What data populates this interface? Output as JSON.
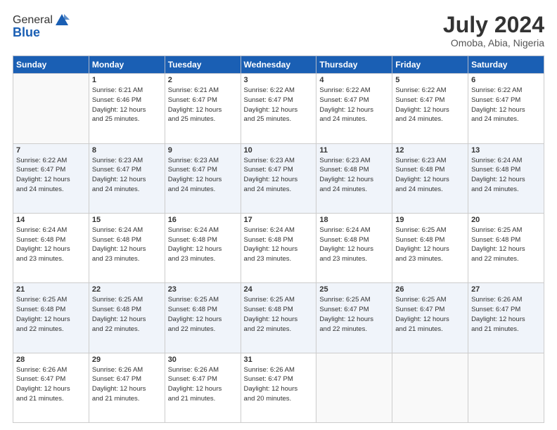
{
  "header": {
    "logo_general": "General",
    "logo_blue": "Blue",
    "month_year": "July 2024",
    "location": "Omoba, Abia, Nigeria"
  },
  "weekdays": [
    "Sunday",
    "Monday",
    "Tuesday",
    "Wednesday",
    "Thursday",
    "Friday",
    "Saturday"
  ],
  "weeks": [
    [
      {
        "day": "",
        "detail": ""
      },
      {
        "day": "1",
        "detail": "Sunrise: 6:21 AM\nSunset: 6:46 PM\nDaylight: 12 hours\nand 25 minutes."
      },
      {
        "day": "2",
        "detail": "Sunrise: 6:21 AM\nSunset: 6:47 PM\nDaylight: 12 hours\nand 25 minutes."
      },
      {
        "day": "3",
        "detail": "Sunrise: 6:22 AM\nSunset: 6:47 PM\nDaylight: 12 hours\nand 25 minutes."
      },
      {
        "day": "4",
        "detail": "Sunrise: 6:22 AM\nSunset: 6:47 PM\nDaylight: 12 hours\nand 24 minutes."
      },
      {
        "day": "5",
        "detail": "Sunrise: 6:22 AM\nSunset: 6:47 PM\nDaylight: 12 hours\nand 24 minutes."
      },
      {
        "day": "6",
        "detail": "Sunrise: 6:22 AM\nSunset: 6:47 PM\nDaylight: 12 hours\nand 24 minutes."
      }
    ],
    [
      {
        "day": "7",
        "detail": "Sunrise: 6:22 AM\nSunset: 6:47 PM\nDaylight: 12 hours\nand 24 minutes."
      },
      {
        "day": "8",
        "detail": "Sunrise: 6:23 AM\nSunset: 6:47 PM\nDaylight: 12 hours\nand 24 minutes."
      },
      {
        "day": "9",
        "detail": "Sunrise: 6:23 AM\nSunset: 6:47 PM\nDaylight: 12 hours\nand 24 minutes."
      },
      {
        "day": "10",
        "detail": "Sunrise: 6:23 AM\nSunset: 6:47 PM\nDaylight: 12 hours\nand 24 minutes."
      },
      {
        "day": "11",
        "detail": "Sunrise: 6:23 AM\nSunset: 6:48 PM\nDaylight: 12 hours\nand 24 minutes."
      },
      {
        "day": "12",
        "detail": "Sunrise: 6:23 AM\nSunset: 6:48 PM\nDaylight: 12 hours\nand 24 minutes."
      },
      {
        "day": "13",
        "detail": "Sunrise: 6:24 AM\nSunset: 6:48 PM\nDaylight: 12 hours\nand 24 minutes."
      }
    ],
    [
      {
        "day": "14",
        "detail": "Sunrise: 6:24 AM\nSunset: 6:48 PM\nDaylight: 12 hours\nand 23 minutes."
      },
      {
        "day": "15",
        "detail": "Sunrise: 6:24 AM\nSunset: 6:48 PM\nDaylight: 12 hours\nand 23 minutes."
      },
      {
        "day": "16",
        "detail": "Sunrise: 6:24 AM\nSunset: 6:48 PM\nDaylight: 12 hours\nand 23 minutes."
      },
      {
        "day": "17",
        "detail": "Sunrise: 6:24 AM\nSunset: 6:48 PM\nDaylight: 12 hours\nand 23 minutes."
      },
      {
        "day": "18",
        "detail": "Sunrise: 6:24 AM\nSunset: 6:48 PM\nDaylight: 12 hours\nand 23 minutes."
      },
      {
        "day": "19",
        "detail": "Sunrise: 6:25 AM\nSunset: 6:48 PM\nDaylight: 12 hours\nand 23 minutes."
      },
      {
        "day": "20",
        "detail": "Sunrise: 6:25 AM\nSunset: 6:48 PM\nDaylight: 12 hours\nand 22 minutes."
      }
    ],
    [
      {
        "day": "21",
        "detail": "Sunrise: 6:25 AM\nSunset: 6:48 PM\nDaylight: 12 hours\nand 22 minutes."
      },
      {
        "day": "22",
        "detail": "Sunrise: 6:25 AM\nSunset: 6:48 PM\nDaylight: 12 hours\nand 22 minutes."
      },
      {
        "day": "23",
        "detail": "Sunrise: 6:25 AM\nSunset: 6:48 PM\nDaylight: 12 hours\nand 22 minutes."
      },
      {
        "day": "24",
        "detail": "Sunrise: 6:25 AM\nSunset: 6:48 PM\nDaylight: 12 hours\nand 22 minutes."
      },
      {
        "day": "25",
        "detail": "Sunrise: 6:25 AM\nSunset: 6:47 PM\nDaylight: 12 hours\nand 22 minutes."
      },
      {
        "day": "26",
        "detail": "Sunrise: 6:25 AM\nSunset: 6:47 PM\nDaylight: 12 hours\nand 21 minutes."
      },
      {
        "day": "27",
        "detail": "Sunrise: 6:26 AM\nSunset: 6:47 PM\nDaylight: 12 hours\nand 21 minutes."
      }
    ],
    [
      {
        "day": "28",
        "detail": "Sunrise: 6:26 AM\nSunset: 6:47 PM\nDaylight: 12 hours\nand 21 minutes."
      },
      {
        "day": "29",
        "detail": "Sunrise: 6:26 AM\nSunset: 6:47 PM\nDaylight: 12 hours\nand 21 minutes."
      },
      {
        "day": "30",
        "detail": "Sunrise: 6:26 AM\nSunset: 6:47 PM\nDaylight: 12 hours\nand 21 minutes."
      },
      {
        "day": "31",
        "detail": "Sunrise: 6:26 AM\nSunset: 6:47 PM\nDaylight: 12 hours\nand 20 minutes."
      },
      {
        "day": "",
        "detail": ""
      },
      {
        "day": "",
        "detail": ""
      },
      {
        "day": "",
        "detail": ""
      }
    ]
  ]
}
